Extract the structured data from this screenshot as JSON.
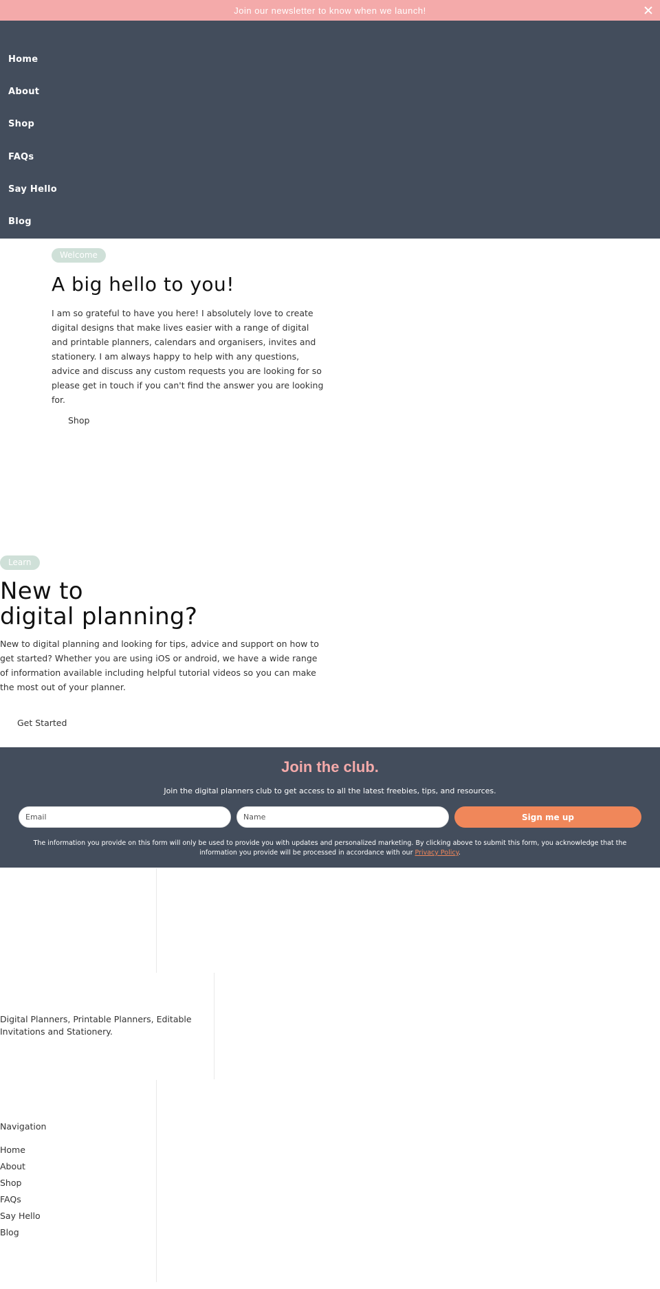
{
  "announcement": {
    "text": "Join our newsletter to know when we launch!",
    "close_icon": "close-icon"
  },
  "nav": {
    "items": [
      {
        "label": "Home"
      },
      {
        "label": "About"
      },
      {
        "label": "Shop"
      },
      {
        "label": "FAQs"
      },
      {
        "label": "Say Hello"
      },
      {
        "label": "Blog"
      }
    ]
  },
  "welcome": {
    "tag": "Welcome",
    "title": "A big hello to you!",
    "body": "I am so grateful to have you here! I absolutely love to create digital designs that make lives easier with a range of digital and printable planners, calendars and organisers, invites and stationery. I am always happy to help with any questions, advice and discuss any custom requests you are looking for so please get in touch if you can't find the answer you are looking for.",
    "button_label": "Shop"
  },
  "learn": {
    "tag": "Learn",
    "title_line1": "New to",
    "title_line2": "digital planning?",
    "body": "New to digital planning and looking for tips, advice and support on how to get started? Whether you are using iOS or android, we have a wide range of information available including helpful tutorial videos so you can make the most out of your planner.",
    "button_label": "Get Started"
  },
  "club": {
    "title": "Join the club.",
    "subtitle": "Join the digital planners club to get access to all the latest freebies, tips, and resources.",
    "email_placeholder": "Email",
    "name_placeholder": "Name",
    "submit_label": "Sign me up",
    "legal_text": "The information you provide on this form will only be used to provide you with updates and personalized marketing. By clicking above to submit this form, you acknowledge that the information you provide will be processed in accordance with our ",
    "privacy_link": "Privacy Policy",
    "legal_end": "."
  },
  "footer": {
    "description": "Digital Planners, Printable Planners, Editable Invitations and Stationery.",
    "nav_title": "Navigation",
    "links": [
      {
        "label": "Home"
      },
      {
        "label": "About"
      },
      {
        "label": "Shop"
      },
      {
        "label": "FAQs"
      },
      {
        "label": "Say Hello"
      },
      {
        "label": "Blog"
      }
    ]
  },
  "colors": {
    "announcement_bg": "#f4aaaa",
    "nav_bg": "#434d5c",
    "tag_bg": "#cfe0d8",
    "accent_orange": "#f0875a",
    "club_title": "#f4aaaa"
  }
}
